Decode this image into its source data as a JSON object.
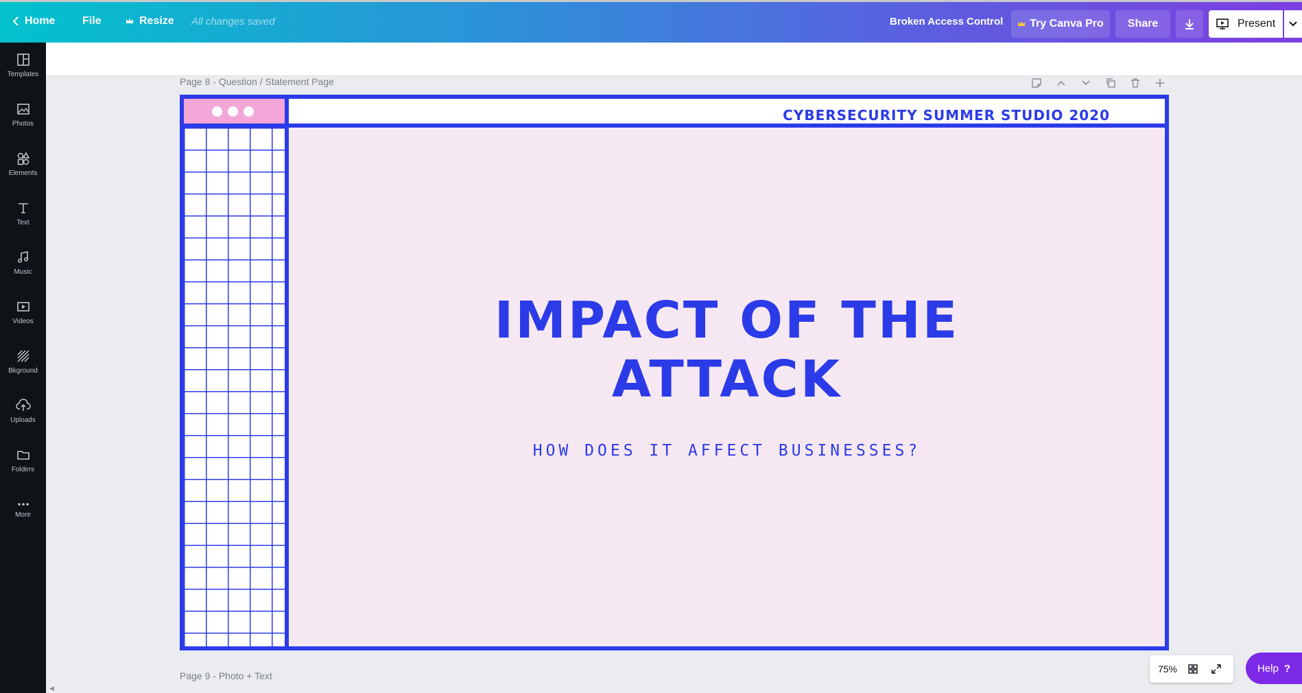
{
  "topbar": {
    "home": "Home",
    "file": "File",
    "resize": "Resize",
    "saved_status": "All changes saved",
    "doc_title": "Broken Access Control",
    "try_pro": "Try Canva Pro",
    "share": "Share",
    "present": "Present"
  },
  "sidebar": {
    "items": [
      {
        "label": "Templates",
        "icon": "templates-icon"
      },
      {
        "label": "Photos",
        "icon": "photos-icon"
      },
      {
        "label": "Elements",
        "icon": "elements-icon"
      },
      {
        "label": "Text",
        "icon": "text-icon"
      },
      {
        "label": "Music",
        "icon": "music-icon"
      },
      {
        "label": "Videos",
        "icon": "videos-icon"
      },
      {
        "label": "Bkground",
        "icon": "background-icon"
      },
      {
        "label": "Uploads",
        "icon": "uploads-icon"
      },
      {
        "label": "Folders",
        "icon": "folders-icon"
      },
      {
        "label": "More",
        "icon": "more-icon"
      }
    ]
  },
  "canvas": {
    "page8_label": "Page 8 - Question / Statement Page",
    "page9_label": "Page 9 - Photo + Text"
  },
  "slide": {
    "band_text": "CYBERSECURITY SUMMER STUDIO 2020",
    "title_line1": "IMPACT OF THE",
    "title_line2": "ATTACK",
    "subtitle": "HOW DOES IT AFFECT BUSINESSES?"
  },
  "bottom": {
    "zoom": "75%",
    "help": "Help"
  },
  "colors": {
    "accent_blue": "#2c3be8",
    "slide_bg": "#f6e8f2",
    "pink": "#f2a7d8",
    "help_purple": "#7d2ae8"
  }
}
